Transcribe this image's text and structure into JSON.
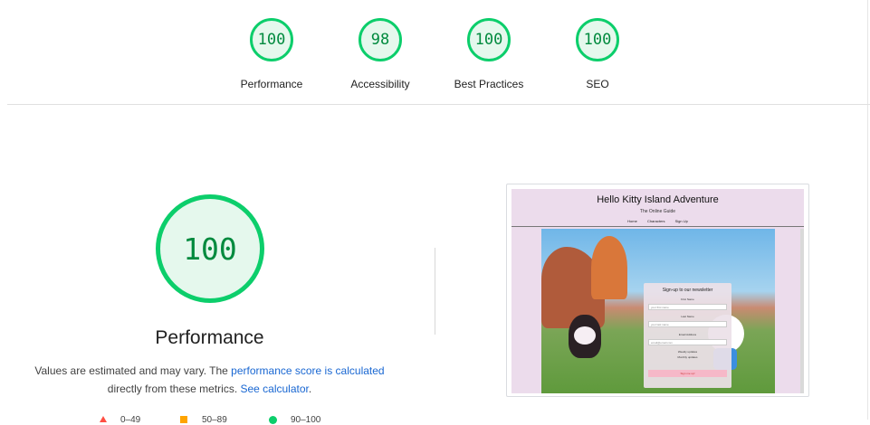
{
  "gauges": [
    {
      "score": "100",
      "label": "Performance"
    },
    {
      "score": "98",
      "label": "Accessibility"
    },
    {
      "score": "100",
      "label": "Best Practices"
    },
    {
      "score": "100",
      "label": "SEO"
    }
  ],
  "main": {
    "score": "100",
    "title": "Performance",
    "desc_prefix": "Values are estimated and may vary. The ",
    "desc_link1": "performance score is calculated",
    "desc_middle": "directly from these metrics. ",
    "desc_link2": "See calculator",
    "desc_suffix": "."
  },
  "legend": [
    {
      "range": "0–49"
    },
    {
      "range": "50–89"
    },
    {
      "range": "90–100"
    }
  ],
  "colors": {
    "pass": "#0cce6b",
    "average": "#ffa400",
    "fail": "#ff4e42",
    "link": "#1967d2"
  },
  "screenshot": {
    "title": "Hello Kitty Island Adventure",
    "subtitle": "The Online Guide",
    "nav": [
      "Home",
      "Characters",
      "Sign Up"
    ],
    "form_heading": "Sign-up to our newsletter",
    "first_name_label": "First Name",
    "first_name_placeholder": "your first name",
    "last_name_label": "Last Name",
    "last_name_placeholder": "your last name",
    "email_label": "Email Address",
    "email_placeholder": "email@email.com",
    "weekly_updates": "Weekly updates",
    "monthly_updates": "Monthly updates",
    "submit": "Sign me up!"
  }
}
